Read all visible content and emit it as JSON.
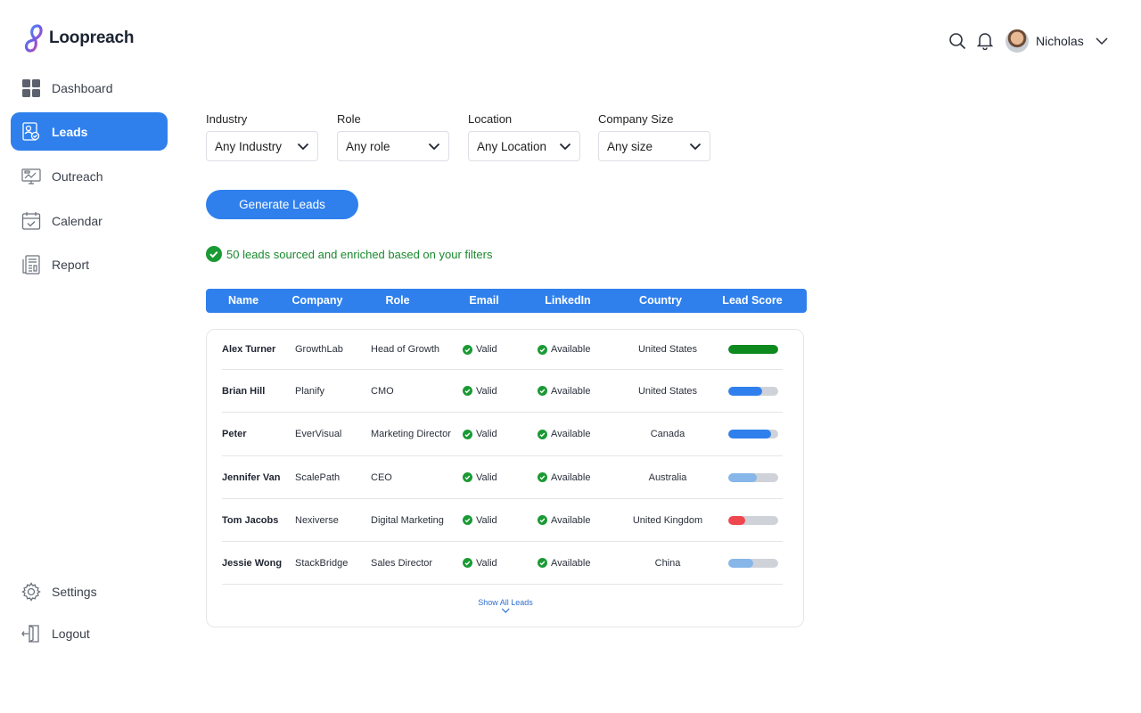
{
  "app": {
    "name": "Loopreach"
  },
  "sidebar": {
    "items": [
      {
        "label": "Dashboard",
        "icon": "dashboard-icon",
        "active": false
      },
      {
        "label": "Leads",
        "icon": "leads-icon",
        "active": true
      },
      {
        "label": "Outreach",
        "icon": "outreach-icon",
        "active": false
      },
      {
        "label": "Calendar",
        "icon": "calendar-icon",
        "active": false
      },
      {
        "label": "Report",
        "icon": "report-icon",
        "active": false
      }
    ],
    "bottom": [
      {
        "label": "Settings",
        "icon": "gear-icon"
      },
      {
        "label": "Logout",
        "icon": "logout-icon"
      }
    ]
  },
  "header": {
    "user_name": "Nicholas"
  },
  "filters": [
    {
      "label": "Industry",
      "value": "Any Industry"
    },
    {
      "label": "Role",
      "value": "Any role"
    },
    {
      "label": "Location",
      "value": "Any Location"
    },
    {
      "label": "Company Size",
      "value": "Any size"
    }
  ],
  "actions": {
    "generate_label": "Generate Leads"
  },
  "status": {
    "text": "50 leads sourced and enriched based on your filters"
  },
  "table": {
    "columns": [
      "Name",
      "Company",
      "Role",
      "Email",
      "LinkedIn",
      "Country",
      "Lead Score"
    ],
    "rows": [
      {
        "name": "Alex Turner",
        "company": "GrowthLab",
        "role": "Head of Growth",
        "email": "Valid",
        "linkedin": "Available",
        "country": "United States",
        "score": 1.0,
        "score_color": "#0f8a1f"
      },
      {
        "name": "Brian Hill",
        "company": "Planify",
        "role": "CMO",
        "email": "Valid",
        "linkedin": "Available",
        "country": "United States",
        "score": 0.68,
        "score_color": "#2f80ed"
      },
      {
        "name": "Peter",
        "company": "EverVisual",
        "role": "Marketing Director",
        "email": "Valid",
        "linkedin": "Available",
        "country": "Canada",
        "score": 0.86,
        "score_color": "#2f80ed"
      },
      {
        "name": "Jennifer Van",
        "company": "ScalePath",
        "role": "CEO",
        "email": "Valid",
        "linkedin": "Available",
        "country": "Australia",
        "score": 0.57,
        "score_color": "#86b7e8"
      },
      {
        "name": "Tom Jacobs",
        "company": "Nexiverse",
        "role": "Digital Marketing",
        "email": "Valid",
        "linkedin": "Available",
        "country": "United Kingdom",
        "score": 0.34,
        "score_color": "#f0474f"
      },
      {
        "name": "Jessie Wong",
        "company": "StackBridge",
        "role": "Sales Director",
        "email": "Valid",
        "linkedin": "Available",
        "country": "China",
        "score": 0.5,
        "score_color": "#86b7e8"
      }
    ],
    "show_all_label": "Show All Leads"
  },
  "colors": {
    "accent": "#2f80ed",
    "success": "#1a8a2e"
  }
}
